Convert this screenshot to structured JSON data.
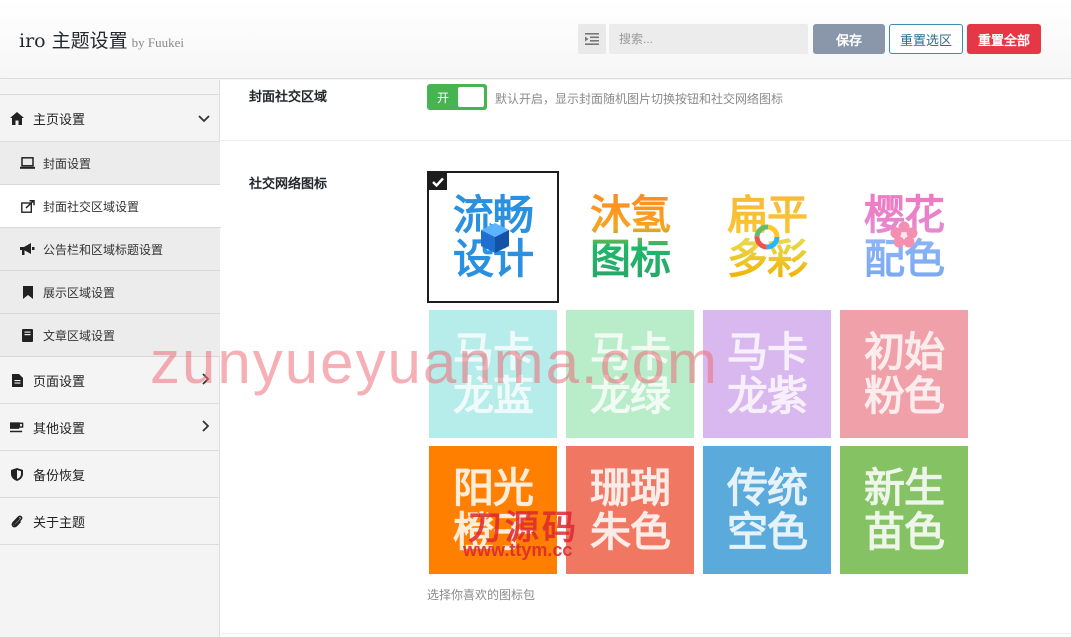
{
  "header": {
    "title": "iro 主题设置",
    "by": "by Fuukei",
    "search_placeholder": "搜索...",
    "save_label": "保存",
    "reset_section_label": "重置选区",
    "reset_all_label": "重置全部"
  },
  "sidebar": {
    "items": [
      {
        "label": "主页设置",
        "icon": "home-icon"
      },
      {
        "label": "封面设置",
        "icon": "laptop-icon"
      },
      {
        "label": "封面社交区域设置",
        "icon": "share-icon"
      },
      {
        "label": "公告栏和区域标题设置",
        "icon": "bullhorn-icon"
      },
      {
        "label": "展示区域设置",
        "icon": "bookmark-icon"
      },
      {
        "label": "文章区域设置",
        "icon": "book-icon"
      },
      {
        "label": "页面设置",
        "icon": "file-icon"
      },
      {
        "label": "其他设置",
        "icon": "coffee-icon"
      },
      {
        "label": "备份恢复",
        "icon": "shield-icon"
      },
      {
        "label": "关于主题",
        "icon": "paperclip-icon"
      }
    ]
  },
  "main": {
    "cover_social": {
      "label": "封面社交区域",
      "toggle_label": "开",
      "toggle_on": true,
      "desc": "默认开启，显示封面随机图片切换按钮和社交网络图标"
    },
    "social_icons": {
      "label": "社交网络图标",
      "desc": "选择你喜欢的图标包",
      "selected_index": 0,
      "options": [
        {
          "text": "流畅设计"
        },
        {
          "text": "沐氢图标"
        },
        {
          "text": "扁平多彩"
        },
        {
          "text": "樱花配色"
        },
        {
          "text": "马卡龙蓝"
        },
        {
          "text": "马卡龙绿"
        },
        {
          "text": "马卡龙紫"
        },
        {
          "text": "初始粉色"
        },
        {
          "text": "阳光橙子"
        },
        {
          "text": "珊瑚朱色"
        },
        {
          "text": "传统空色"
        },
        {
          "text": "新生苗色"
        }
      ]
    }
  },
  "watermarks": {
    "site": "zunyueyuanma.com",
    "brand_cn": "刀源码",
    "brand_url": "www.ttym.cc"
  },
  "colors": {
    "accent_green": "#46b450",
    "save_button": "#8a97ab",
    "danger": "#e43847"
  }
}
